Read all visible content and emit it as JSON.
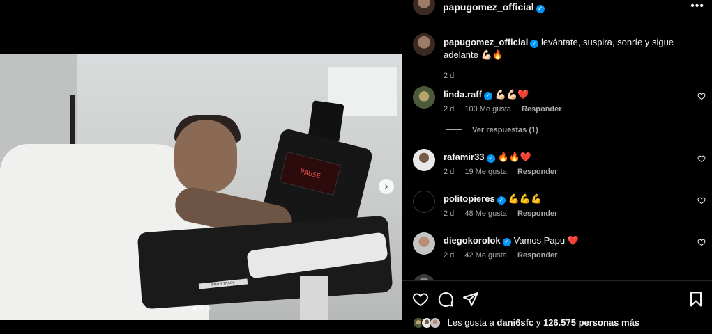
{
  "post": {
    "username": "papugomez_official",
    "more_label": "•••"
  },
  "media": {
    "console_text": "PAUSE",
    "strip_text": "SMITH TRACK",
    "next_label": "›",
    "slides": 3,
    "active_slide": 1
  },
  "caption": {
    "username": "papugomez_official",
    "text": "levántate, suspira, sonríe y sigue adelante 💪🏻🔥",
    "time": "2 d"
  },
  "comments": [
    {
      "username": "linda.raff",
      "text": "💪🏻💪🏻❤️",
      "time": "2 d",
      "likes": "100 Me gusta",
      "reply": "Responder",
      "verified": true
    },
    {
      "username": "rafamir33",
      "text": "🔥🔥❤️",
      "time": "2 d",
      "likes": "19 Me gusta",
      "reply": "Responder",
      "verified": true
    },
    {
      "username": "politopieres",
      "text": "💪💪💪",
      "time": "2 d",
      "likes": "48 Me gusta",
      "reply": "Responder",
      "verified": true
    },
    {
      "username": "diegokorolok",
      "text": "Vamos Papu ❤️",
      "time": "2 d",
      "likes": "42 Me gusta",
      "reply": "Responder",
      "verified": true
    }
  ],
  "view_replies": "Ver respuestas (1)",
  "likes": {
    "prefix": "Les gusta a",
    "user": "dani6sfc",
    "middle": "y",
    "count": "126.575 personas más"
  },
  "colors": {
    "background": "#000000",
    "verified": "#0095f6",
    "heart": "#ed4956",
    "muted": "#a8a8a8"
  }
}
